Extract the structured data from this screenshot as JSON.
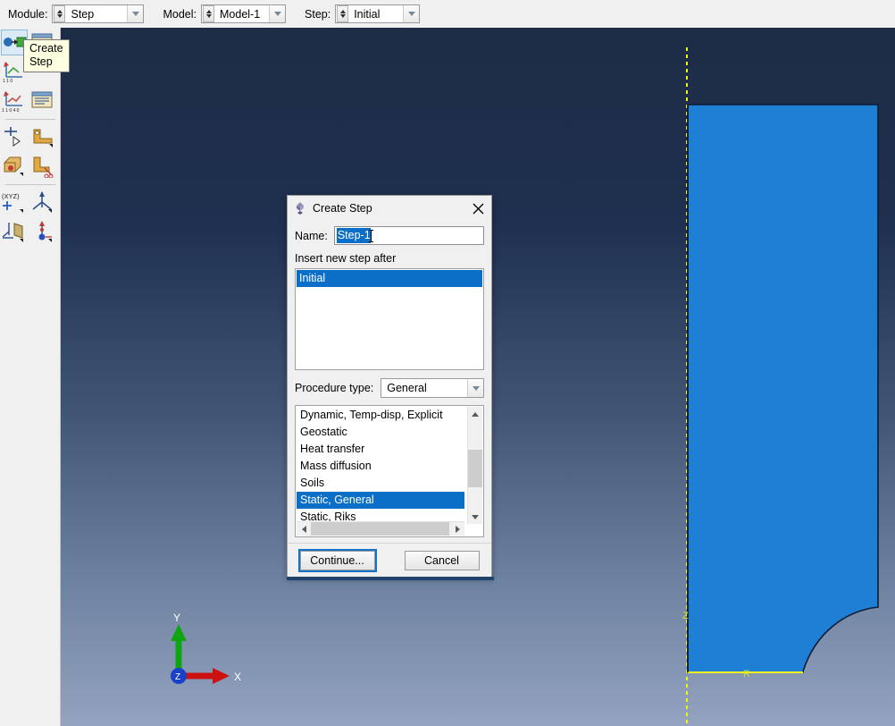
{
  "topbar": {
    "module": {
      "label": "Module:",
      "value": "Step"
    },
    "model": {
      "label": "Model:",
      "value": "Model-1"
    },
    "step": {
      "label": "Step:",
      "value": "Initial"
    }
  },
  "tooltip": {
    "line1": "Create",
    "line2": "Step"
  },
  "toolbar": {
    "icons": [
      "create-step-icon",
      "step-manager-icon",
      "create-output-request-icon",
      "field-output-manager-icon",
      "history-output-icon",
      "history-output-manager-icon",
      "create-adaptive-mesh-icon",
      "create-alm-control-icon",
      "adaptive-mesh-manager-icon",
      "diagnostic-trim-icon",
      "create-coordinate-xyz-icon",
      "create-datum-csys-icon",
      "create-datum-plane-icon",
      "create-datum-point-icon"
    ]
  },
  "dialog": {
    "title": "Create Step",
    "icon": "abaqus-dialog-icon",
    "close_icon": "close-icon",
    "name_label": "Name:",
    "name_value": "Step-1",
    "insert_label": "Insert new step after",
    "steps": [
      "Initial"
    ],
    "steps_selected": "Initial",
    "procedure_type_label": "Procedure type:",
    "procedure_type_value": "General",
    "procedures": [
      "Dynamic, Temp-disp, Explicit",
      "Geostatic",
      "Heat transfer",
      "Mass diffusion",
      "Soils",
      "Static, General",
      "Static, Riks"
    ],
    "procedure_selected": "Static, General",
    "continue_label": "Continue...",
    "cancel_label": "Cancel"
  },
  "viewport": {
    "axis_labels": {
      "z": "Z",
      "r": "R"
    },
    "triad": {
      "x": "X",
      "y": "Y",
      "z": "Z"
    },
    "colors": {
      "part_fill": "#1f7fd4",
      "part_edge": "#0d1a33",
      "axis_dashed": "#f2f21e",
      "bg_top": "#1d2c45",
      "bg_bottom": "#94a3bf",
      "triad_x": "#cc1111",
      "triad_y": "#10a510",
      "triad_z": "#1a3fc9"
    }
  }
}
